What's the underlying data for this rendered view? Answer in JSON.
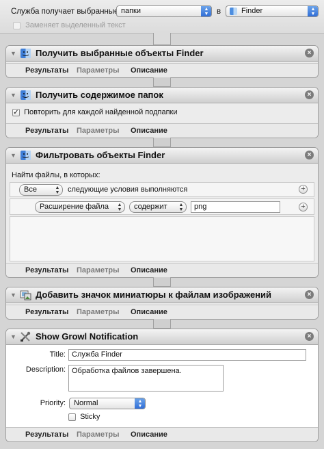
{
  "service_bar": {
    "receives_label": "Служба получает выбранные",
    "input_type": "папки",
    "in_label": "в",
    "application": "Finder",
    "replaces_text_label": "Заменяет выделенный текст"
  },
  "footer_tabs": {
    "results": "Результаты",
    "options": "Параметры",
    "description": "Описание"
  },
  "actions": [
    {
      "title": "Получить выбранные объекты Finder",
      "icon": "finder-icon"
    },
    {
      "title": "Получить содержимое папок",
      "icon": "finder-icon",
      "repeat_label": "Повторить для каждой найденной подпапки",
      "repeat_checked": true
    },
    {
      "title": "Фильтровать объекты Finder",
      "icon": "finder-icon",
      "find_label": "Найти файлы, в которых:",
      "match_mode": "Все",
      "match_text": "следующие условия выполняются",
      "criterion_attribute": "Расширение файла",
      "criterion_operator": "содержит",
      "criterion_value": "png"
    },
    {
      "title": "Добавить значок миниатюры к файлам изображений",
      "icon": "image-thumbnail-icon"
    },
    {
      "title": "Show Growl Notification",
      "icon": "growl-tools-icon",
      "title_label": "Title:",
      "title_value": "Служба Finder",
      "description_label": "Description:",
      "description_value": "Обработка файлов завершена.",
      "priority_label": "Priority:",
      "priority_value": "Normal",
      "sticky_label": "Sticky",
      "sticky_checked": false
    }
  ]
}
